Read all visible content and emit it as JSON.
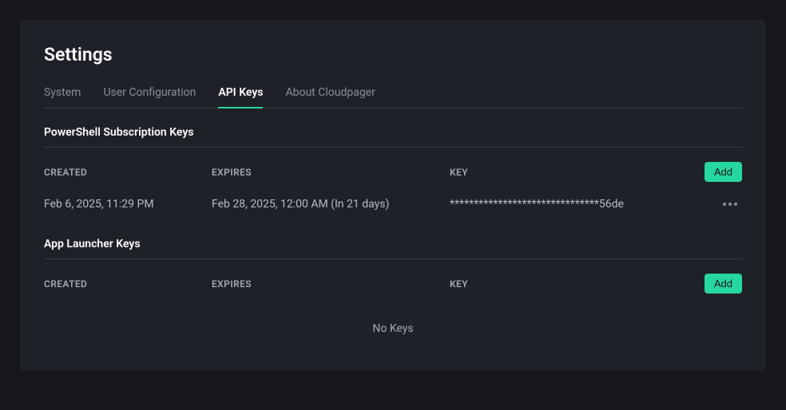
{
  "pageTitle": "Settings",
  "tabs": [
    {
      "label": "System",
      "active": false
    },
    {
      "label": "User Configuration",
      "active": false
    },
    {
      "label": "API Keys",
      "active": true
    },
    {
      "label": "About Cloudpager",
      "active": false
    }
  ],
  "columns": {
    "created": "CREATED",
    "expires": "EXPIRES",
    "key": "KEY"
  },
  "addLabel": "Add",
  "sections": {
    "powershell": {
      "title": "PowerShell Subscription Keys",
      "rows": [
        {
          "created": "Feb 6, 2025, 11:29 PM",
          "expires": "Feb 28, 2025, 12:00 AM (In 21 days)",
          "key": "*******************************56de"
        }
      ]
    },
    "appLauncher": {
      "title": "App Launcher Keys",
      "rows": [],
      "emptyText": "No Keys"
    }
  }
}
